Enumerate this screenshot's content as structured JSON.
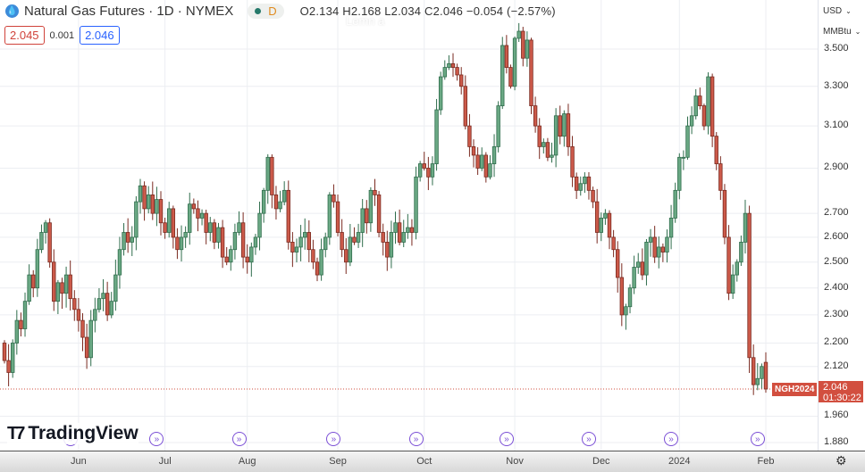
{
  "header": {
    "title": "Natural Gas Futures · 1D · NYMEX",
    "status_letter": "D",
    "ohlc": "O2.134 H2.168 L2.034 C2.046 −0.054 (−2.57%)",
    "watermark": "Lemn a"
  },
  "quotes": {
    "bid": "2.045",
    "spread": "0.001",
    "ask": "2.046"
  },
  "axis": {
    "currency": "USD",
    "unit": "MMBtu"
  },
  "last": {
    "symbol": "NGH2024",
    "price": "2.046",
    "countdown": "01:30:22"
  },
  "brand": "TradingView",
  "colors": {
    "up": "#6aa884",
    "up_border": "#2f6d4c",
    "down": "#cc5a4a",
    "down_border": "#7a2a20",
    "last_line": "#d24f3f",
    "event": "#7b4fd6"
  },
  "chart_data": {
    "type": "candlestick",
    "title": "Natural Gas Futures · 1D · NYMEX",
    "ylim": [
      1.86,
      3.62
    ],
    "yscale": "log",
    "yticks": [
      "3.500",
      "3.300",
      "3.100",
      "2.900",
      "2.700",
      "2.600",
      "2.500",
      "2.400",
      "2.300",
      "2.200",
      "2.120",
      "1.960",
      "1.880"
    ],
    "xticks": [
      {
        "label": "Jun",
        "bar_index": 18
      },
      {
        "label": "Jul",
        "bar_index": 39
      },
      {
        "label": "Aug",
        "bar_index": 59
      },
      {
        "label": "Sep",
        "bar_index": 81
      },
      {
        "label": "Oct",
        "bar_index": 102
      },
      {
        "label": "Nov",
        "bar_index": 124
      },
      {
        "label": "Dec",
        "bar_index": 145
      },
      {
        "label": "2024",
        "bar_index": 164
      },
      {
        "label": "Feb",
        "bar_index": 185
      }
    ],
    "first_open": 2.2,
    "closes": [
      2.14,
      2.1,
      2.2,
      2.28,
      2.25,
      2.35,
      2.45,
      2.4,
      2.55,
      2.62,
      2.66,
      2.5,
      2.35,
      2.42,
      2.38,
      2.45,
      2.36,
      2.32,
      2.28,
      2.22,
      2.15,
      2.28,
      2.32,
      2.36,
      2.38,
      2.3,
      2.35,
      2.45,
      2.55,
      2.62,
      2.58,
      2.6,
      2.75,
      2.82,
      2.72,
      2.78,
      2.7,
      2.76,
      2.66,
      2.62,
      2.72,
      2.6,
      2.55,
      2.6,
      2.62,
      2.74,
      2.72,
      2.68,
      2.7,
      2.62,
      2.66,
      2.58,
      2.64,
      2.52,
      2.5,
      2.55,
      2.62,
      2.66,
      2.52,
      2.5,
      2.56,
      2.6,
      2.7,
      2.8,
      2.95,
      2.78,
      2.72,
      2.75,
      2.8,
      2.58,
      2.54,
      2.56,
      2.6,
      2.62,
      2.55,
      2.5,
      2.45,
      2.55,
      2.6,
      2.78,
      2.75,
      2.62,
      2.55,
      2.5,
      2.6,
      2.58,
      2.62,
      2.72,
      2.66,
      2.8,
      2.78,
      2.62,
      2.58,
      2.52,
      2.62,
      2.66,
      2.58,
      2.62,
      2.64,
      2.62,
      2.86,
      2.92,
      2.9,
      2.86,
      2.92,
      3.18,
      3.35,
      3.4,
      3.42,
      3.4,
      3.36,
      3.3,
      3.1,
      3.0,
      2.96,
      2.9,
      2.96,
      2.86,
      2.92,
      3.0,
      3.2,
      3.52,
      3.4,
      3.3,
      3.56,
      3.6,
      3.45,
      3.55,
      3.2,
      3.1,
      3.0,
      3.02,
      2.95,
      2.96,
      3.15,
      3.05,
      3.16,
      3.0,
      2.86,
      2.8,
      2.83,
      2.86,
      2.8,
      2.75,
      2.62,
      2.68,
      2.7,
      2.6,
      2.55,
      2.44,
      2.3,
      2.33,
      2.4,
      2.48,
      2.5,
      2.45,
      2.58,
      2.6,
      2.52,
      2.56,
      2.54,
      2.6,
      2.68,
      2.8,
      2.95,
      2.95,
      3.1,
      3.15,
      3.25,
      3.2,
      3.1,
      3.35,
      3.05,
      2.92,
      2.8,
      2.6,
      2.38,
      2.45,
      2.5,
      2.58,
      2.7,
      2.15,
      2.06,
      2.08,
      2.12,
      2.046
    ],
    "last_bar": {
      "open": 2.134,
      "high": 2.168,
      "low": 2.034,
      "close": 2.046
    },
    "event_bar_indices": [
      16,
      37,
      57,
      80,
      100,
      122,
      142,
      162,
      183
    ]
  }
}
